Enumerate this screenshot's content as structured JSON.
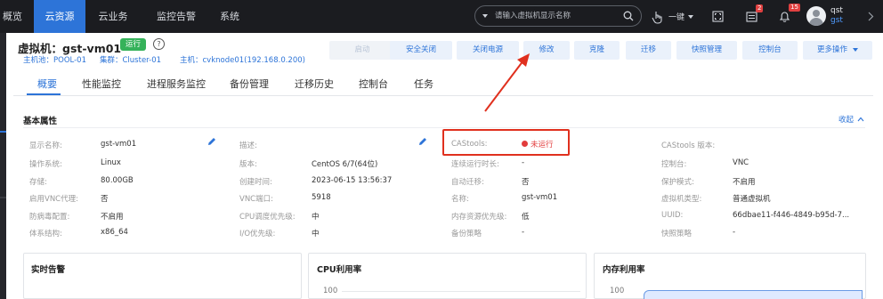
{
  "topnav": {
    "items": [
      {
        "label": "概览",
        "active": false
      },
      {
        "label": "云资源",
        "active": true
      },
      {
        "label": "云业务",
        "active": false
      },
      {
        "label": "监控告警",
        "active": false
      },
      {
        "label": "系统",
        "active": false
      }
    ]
  },
  "search": {
    "placeholder": "请输入虚拟机显示名称"
  },
  "toolbar": {
    "one_click_label": "一键",
    "task_badge": "2",
    "alarm_badge": "15",
    "user_name": "qst",
    "user_sub": "gst"
  },
  "vm": {
    "title": "虚拟机：gst-vm01",
    "status": "运行",
    "help": "?",
    "host_pool": "主机池：POOL-01",
    "cluster": "集群：Cluster-01",
    "host": "主机：cvknode01(192.168.0.200)"
  },
  "actions": [
    {
      "label": "启动",
      "disabled": true
    },
    {
      "label": "安全关闭",
      "disabled": false
    },
    {
      "label": "关闭电源",
      "disabled": false
    },
    {
      "label": "修改",
      "disabled": false
    },
    {
      "label": "克隆",
      "disabled": false
    },
    {
      "label": "迁移",
      "disabled": false
    },
    {
      "label": "快照管理",
      "disabled": false
    },
    {
      "label": "控制台",
      "disabled": false
    },
    {
      "label": "更多操作",
      "disabled": false
    }
  ],
  "tabs": [
    "概要",
    "性能监控",
    "进程服务监控",
    "备份管理",
    "迁移历史",
    "控制台",
    "任务"
  ],
  "basic": {
    "title": "基本属性",
    "collapse": "收起",
    "columns": [
      [
        {
          "label": "显示名称:",
          "value": "gst-vm01"
        },
        {
          "label": "操作系统:",
          "value": "Linux"
        },
        {
          "label": "存储:",
          "value": "80.00GB"
        },
        {
          "label": "启用VNC代理:",
          "value": "否"
        },
        {
          "label": "防病毒配置:",
          "value": "不启用"
        },
        {
          "label": "体系结构:",
          "value": "x86_64"
        }
      ],
      [
        {
          "label": "描述:",
          "value": ""
        },
        {
          "label": "版本:",
          "value": "CentOS 6/7(64位)"
        },
        {
          "label": "创建时间:",
          "value": "2023-06-15 13:56:37"
        },
        {
          "label": "VNC端口:",
          "value": "5918"
        },
        {
          "label": "CPU调度优先级:",
          "value": "中"
        },
        {
          "label": "I/O优先级:",
          "value": "中"
        }
      ],
      [
        {
          "label": "CAStools:",
          "value": "未运行"
        },
        {
          "label": "连续运行时长:",
          "value": "-"
        },
        {
          "label": "自动迁移:",
          "value": "否"
        },
        {
          "label": "名称:",
          "value": "gst-vm01"
        },
        {
          "label": "内存资源优先级:",
          "value": "低"
        },
        {
          "label": "备份策略",
          "value": "-"
        }
      ],
      [
        {
          "label": "CAStools 版本:",
          "value": ""
        },
        {
          "label": "控制台:",
          "value": "VNC"
        },
        {
          "label": "保护模式:",
          "value": "不启用"
        },
        {
          "label": "虚拟机类型:",
          "value": "普通虚拟机"
        },
        {
          "label": "UUID:",
          "value": "66dbae11-f446-4849-b95d-7..."
        },
        {
          "label": "快照策略",
          "value": "-"
        }
      ]
    ]
  },
  "cards": [
    {
      "title": "实时告警",
      "axis": ""
    },
    {
      "title": "CPU利用率",
      "axis": "100"
    },
    {
      "title": "内存利用率",
      "axis": "100"
    }
  ],
  "colors": {
    "accent": "#2d74d8",
    "running": "#35b25a",
    "stopped": "#e23c3c",
    "annotation": "#e0301e"
  }
}
